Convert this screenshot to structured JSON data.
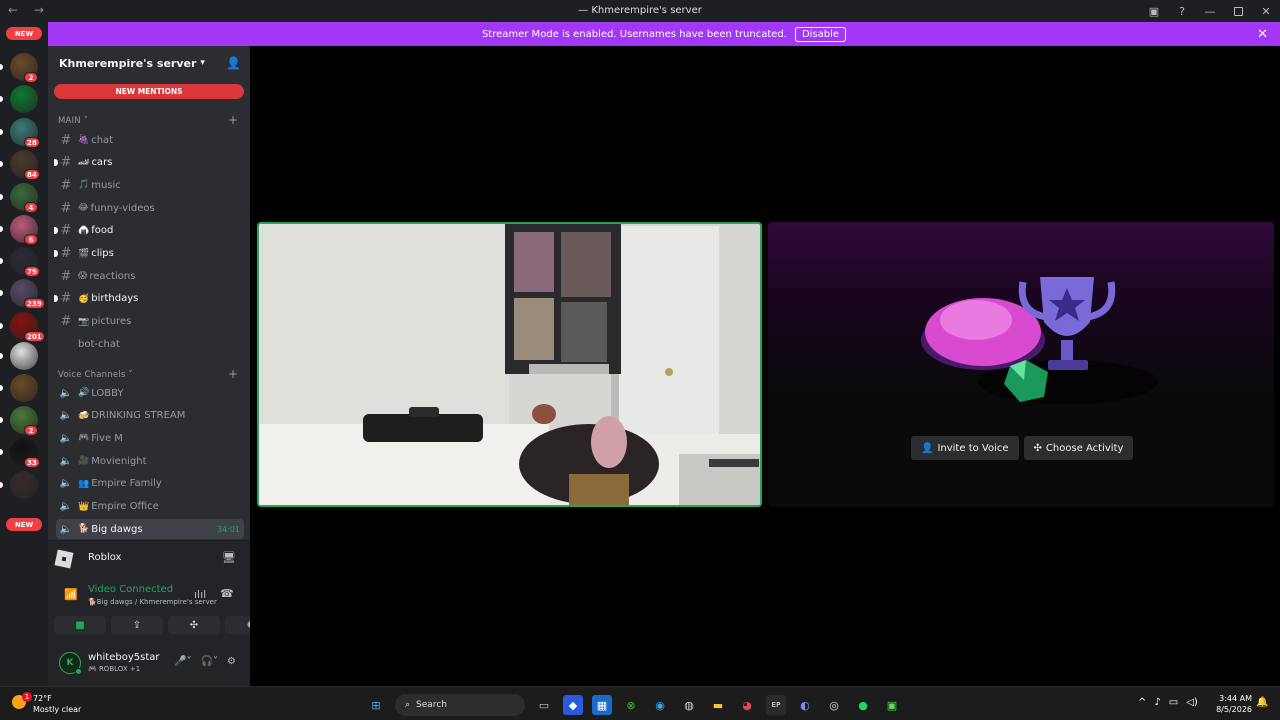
{
  "window": {
    "title": "Khmerempire's server"
  },
  "banner": {
    "text": "Streamer Mode is enabled. Usernames have been truncated.",
    "disable_label": "Disable"
  },
  "servers": {
    "new_top_label": "NEW",
    "new_bottom_label": "NEW",
    "items": [
      {
        "badge": "2",
        "color": "#6b4a2a"
      },
      {
        "badge": "",
        "color": "#0b7a2e"
      },
      {
        "badge": "28",
        "color": "#3a7a7a"
      },
      {
        "badge": "84",
        "color": "#4a3a2a"
      },
      {
        "badge": "4",
        "color": "#3a6a3a"
      },
      {
        "badge": "6",
        "color": "#c05a7a"
      },
      {
        "badge": "79",
        "color": "#2a2a3a"
      },
      {
        "badge": "239",
        "color": "#5a4a6a"
      },
      {
        "badge": "201",
        "color": "#8a1010"
      },
      {
        "badge": "",
        "color": "#e0e0e0"
      },
      {
        "badge": "",
        "color": "#6a4a2a"
      },
      {
        "badge": "2",
        "color": "#4a7a3a"
      },
      {
        "badge": "33",
        "color": "#111111"
      },
      {
        "badge": "",
        "color": "#3a2a2a"
      }
    ]
  },
  "sidebar": {
    "server_name": "Khmerempire's server",
    "new_mentions": "NEW MENTIONS",
    "text_category": "MAIN",
    "voice_category": "Voice Channels",
    "text_channels": [
      {
        "emoji": "🍇",
        "name": "chat",
        "unread": false
      },
      {
        "emoji": "🏎",
        "name": "cars",
        "unread": true
      },
      {
        "emoji": "🎵",
        "name": "music",
        "unread": false
      },
      {
        "emoji": "😂",
        "name": "funny-videos",
        "unread": false
      },
      {
        "emoji": "🍙",
        "name": "food",
        "unread": true
      },
      {
        "emoji": "🎬",
        "name": "clips",
        "unread": true
      },
      {
        "emoji": "😱",
        "name": "reactions",
        "unread": false
      },
      {
        "emoji": "🥳",
        "name": "birthdays",
        "unread": true
      },
      {
        "emoji": "📷",
        "name": "pictures",
        "unread": false
      },
      {
        "emoji": "",
        "name": "bot-chat",
        "unread": false
      }
    ],
    "voice_channels": [
      {
        "emoji": "🔊",
        "name": "LOBBY",
        "timer": ""
      },
      {
        "emoji": "🍻",
        "name": "DRINKING STREAM",
        "timer": ""
      },
      {
        "emoji": "🎮",
        "name": "Five M",
        "timer": ""
      },
      {
        "emoji": "🎥",
        "name": "Movienight",
        "timer": ""
      },
      {
        "emoji": "👥",
        "name": "Empire Family",
        "timer": ""
      },
      {
        "emoji": "👑",
        "name": "Empire Office",
        "timer": ""
      },
      {
        "emoji": "🐕",
        "name": "Big dawgs",
        "timer": "34:01"
      }
    ]
  },
  "activity": {
    "name": "Roblox"
  },
  "voice": {
    "status": "Video Connected",
    "location": "🐕Big dawgs / Khmerempire's server"
  },
  "user": {
    "name": "whiteboy5star",
    "status": "🎮 ROBLOX +1",
    "avatar_text": "K"
  },
  "activity_tile": {
    "invite_label": "Invite to Voice",
    "choose_label": "Choose Activity"
  },
  "taskbar": {
    "temp": "72°F",
    "weather": "Mostly clear",
    "weather_badge": "1",
    "search_label": "Search",
    "time": "3:44 AM",
    "date": "8/5/2026"
  }
}
